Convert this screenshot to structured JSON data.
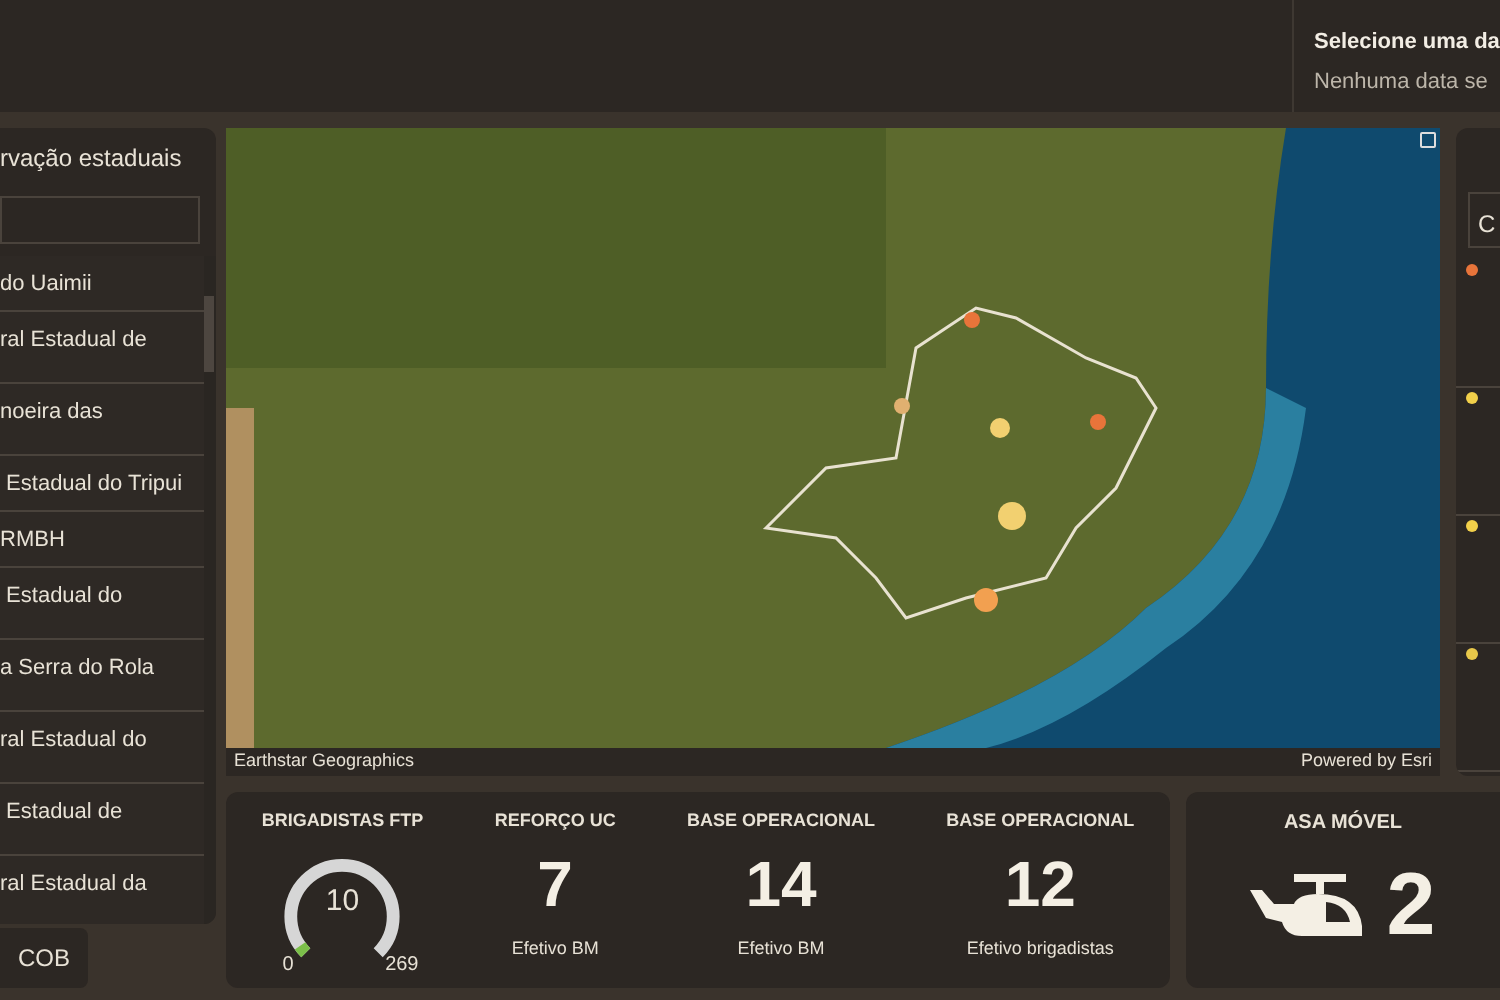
{
  "header": {
    "date_title": "Selecione uma da",
    "date_subtitle": "Nenhuma data se"
  },
  "left_panel": {
    "title": "rvação estaduais",
    "items": [
      {
        "label": "do Uaimii",
        "kind": "one_line"
      },
      {
        "label": "ral Estadual de",
        "kind": "two_line"
      },
      {
        "label": "noeira das",
        "kind": "two_line"
      },
      {
        "label": " Estadual do Tripui",
        "kind": "one_line"
      },
      {
        "label": "RMBH",
        "kind": "one_line"
      },
      {
        "label": " Estadual do",
        "kind": "two_line"
      },
      {
        "label": "a Serra do Rola",
        "kind": "two_line"
      },
      {
        "label": "ral Estadual do",
        "kind": "two_line"
      },
      {
        "label": " Estadual de",
        "kind": "two_line"
      },
      {
        "label": "ral Estadual da",
        "kind": "two_line"
      }
    ]
  },
  "cob_button": "COB",
  "map": {
    "attribution_left": "Earthstar Geographics",
    "attribution_right": "Powered by Esri"
  },
  "right_panel": {
    "search_text": "C",
    "dots": [
      {
        "color": "#e8743a"
      },
      {
        "color": "#f2d04a"
      },
      {
        "color": "#f2d04a"
      },
      {
        "color": "#e8c84a"
      }
    ]
  },
  "stats": {
    "gauge": {
      "title": "BRIGADISTAS FTP",
      "value": "10",
      "min": "0",
      "max": "269",
      "level": 0.037
    },
    "counters": [
      {
        "title": "REFORÇO UC",
        "value": "7",
        "caption": "Efetivo BM"
      },
      {
        "title": "BASE OPERACIONAL",
        "value": "14",
        "caption": "Efetivo BM"
      },
      {
        "title": "BASE OPERACIONAL",
        "value": "12",
        "caption": "Efetivo brigadistas"
      }
    ]
  },
  "aircraft": {
    "title": "ASA MÓVEL",
    "value": "2"
  }
}
